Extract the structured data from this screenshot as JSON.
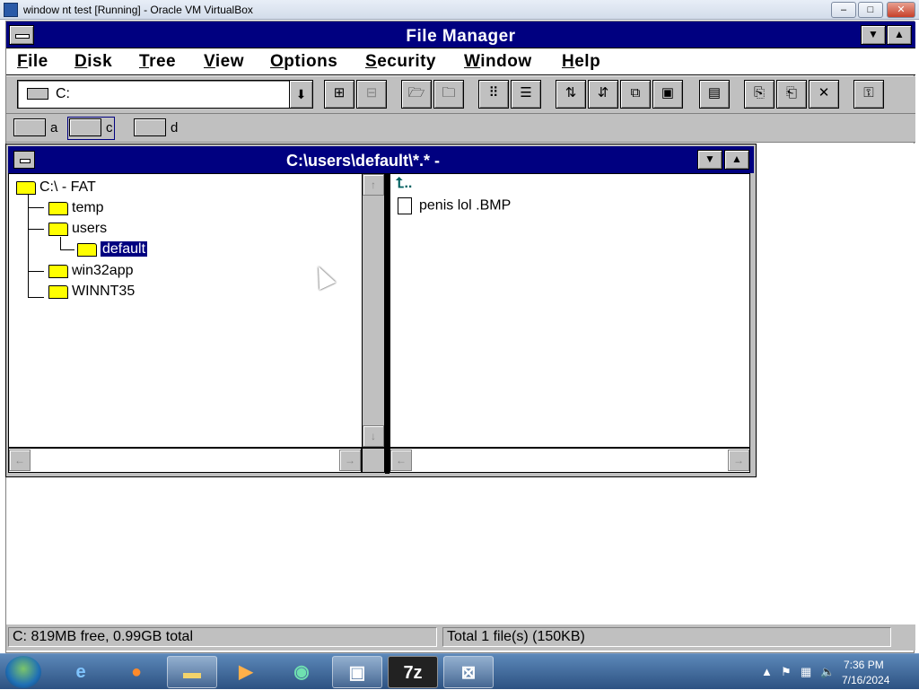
{
  "vbox": {
    "title": "window nt test [Running] - Oracle VM VirtualBox",
    "min": "–",
    "max": "□",
    "close": "✕"
  },
  "app": {
    "title": "File Manager"
  },
  "menu": [
    "File",
    "Disk",
    "Tree",
    "View",
    "Options",
    "Security",
    "Window",
    "Help"
  ],
  "toolbar": {
    "drive_combo": "C:"
  },
  "drives": [
    {
      "letter": "a",
      "icon": "floppy-drive-icon"
    },
    {
      "letter": "c",
      "icon": "hard-drive-icon",
      "selected": true
    },
    {
      "letter": "d",
      "icon": "cdrom-drive-icon"
    }
  ],
  "child": {
    "title": "C:\\users\\default\\*.* -"
  },
  "tree": [
    {
      "label": "C:\\ - FAT",
      "depth": 0
    },
    {
      "label": "temp",
      "depth": 1
    },
    {
      "label": "users",
      "depth": 1
    },
    {
      "label": "default",
      "depth": 2,
      "selected": true
    },
    {
      "label": "win32app",
      "depth": 1
    },
    {
      "label": "WINNT35",
      "depth": 1
    }
  ],
  "files": [
    {
      "name": "..",
      "icon": "up-arrow-icon"
    },
    {
      "name": "penis lol .BMP",
      "icon": "document-icon"
    }
  ],
  "status": {
    "left": "C: 819MB free,  0.99GB total",
    "right": "Total 1 file(s) (150KB)"
  },
  "taskbar": {
    "time": "7:36 PM",
    "date": "7/16/2024",
    "pinned": [
      "internet-explorer-icon",
      "firefox-icon",
      "file-explorer-icon",
      "media-player-icon",
      "cd-burner-icon",
      "virtualbox-icon",
      "7zip-icon",
      "virtualbox-nt-icon"
    ]
  }
}
